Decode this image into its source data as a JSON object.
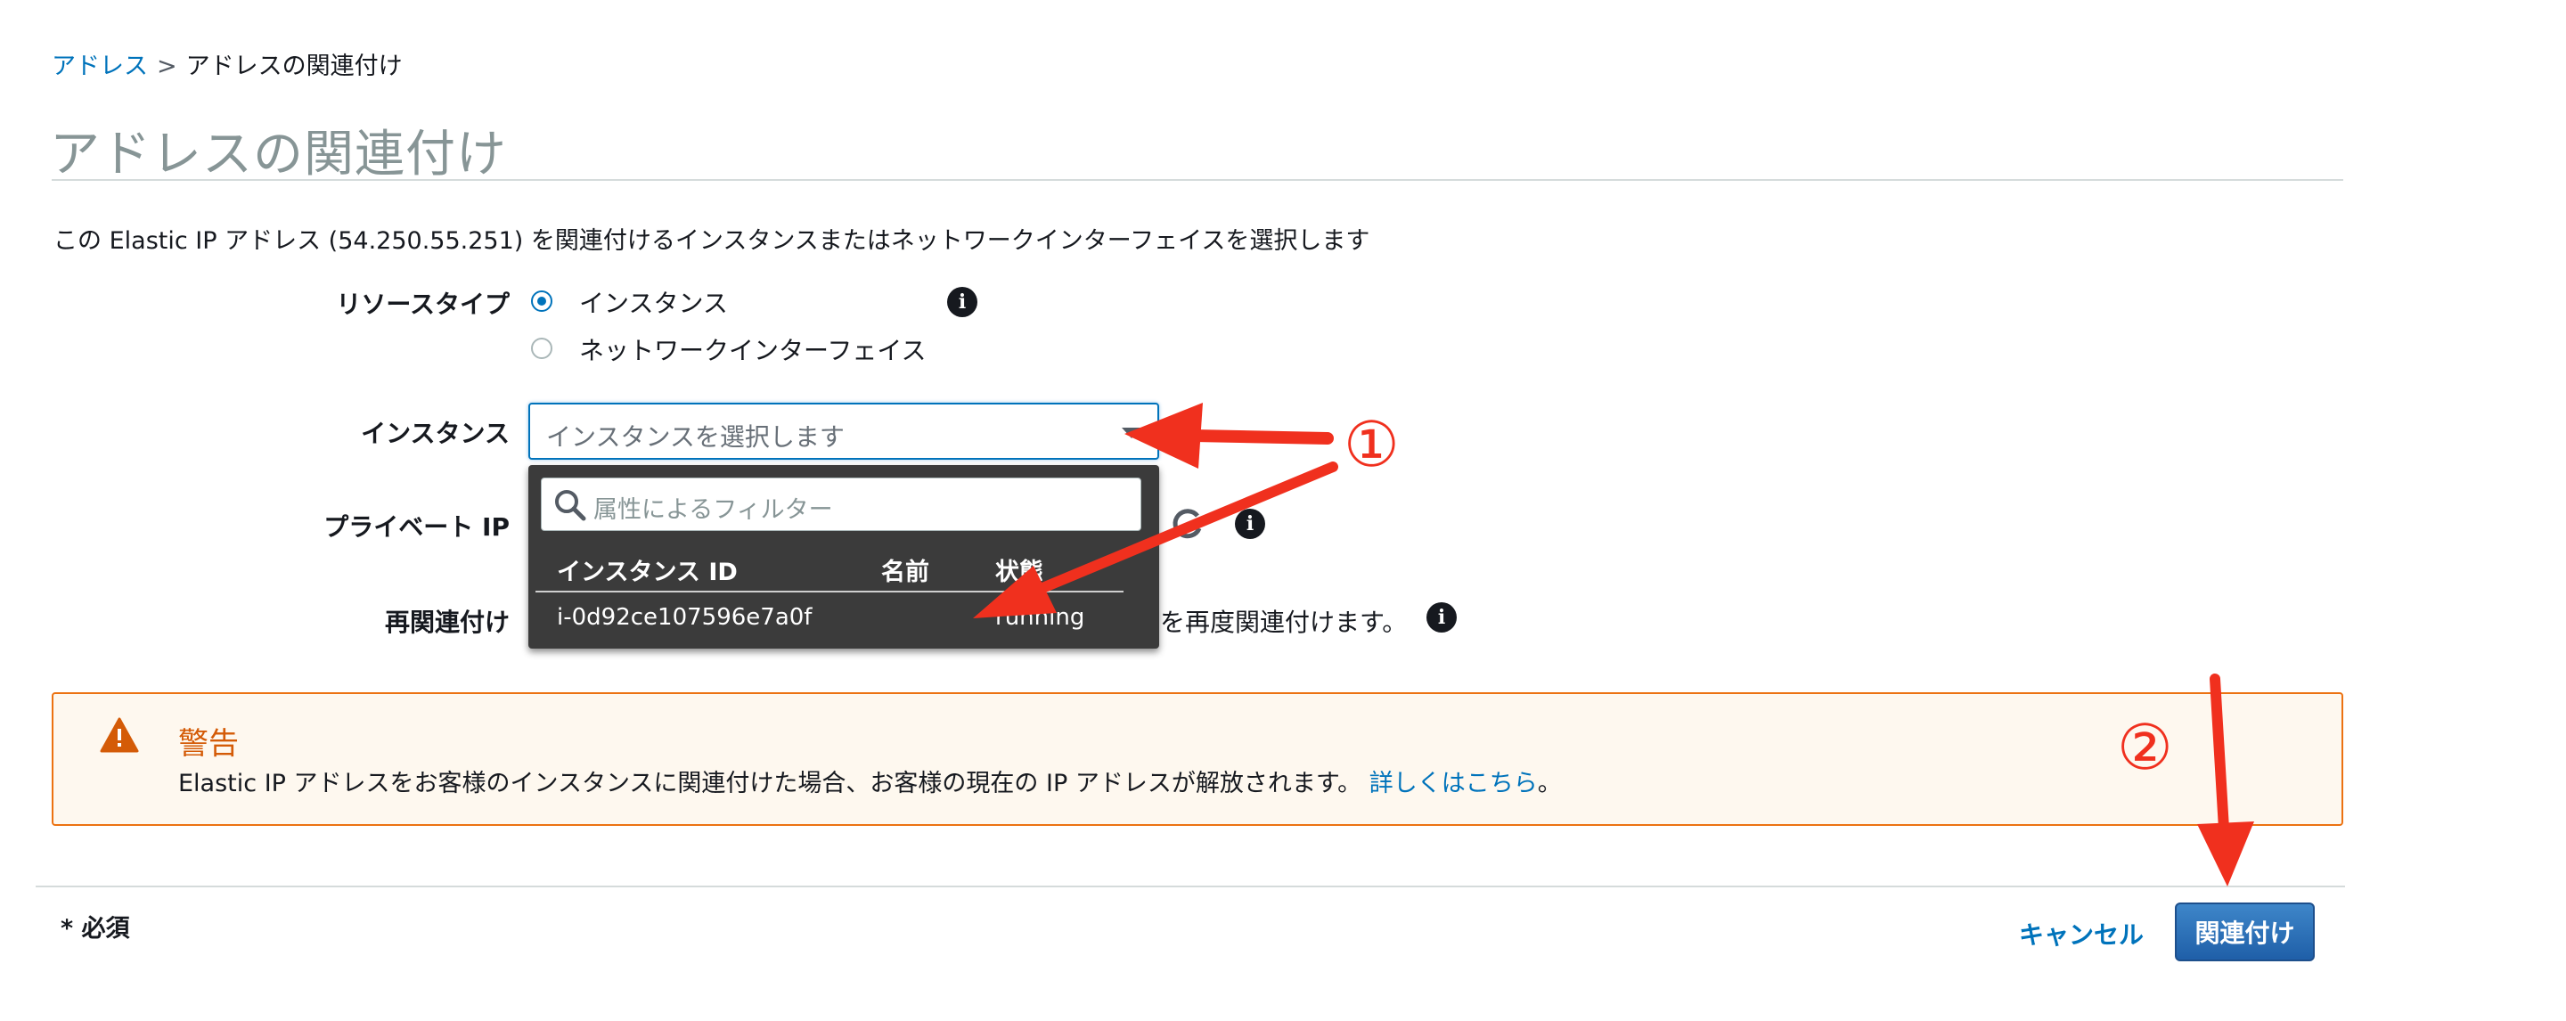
{
  "breadcrumb": {
    "parent": "アドレス",
    "separator": ">",
    "current": "アドレスの関連付け"
  },
  "page_title": "アドレスの関連付け",
  "description": "この Elastic IP アドレス (54.250.55.251) を関連付けるインスタンスまたはネットワークインターフェイスを選択します",
  "form": {
    "resource_type": {
      "label": "リソースタイプ",
      "options": [
        {
          "label": "インスタンス",
          "selected": true
        },
        {
          "label": "ネットワークインターフェイス",
          "selected": false
        }
      ],
      "info_icon": "i"
    },
    "instance": {
      "label": "インスタンス",
      "placeholder": "インスタンスを選択します",
      "dropdown": {
        "filter_placeholder": "属性によるフィルター",
        "columns": [
          "インスタンス ID",
          "名前",
          "状態"
        ],
        "rows": [
          {
            "id": "i-0d92ce107596e7a0f",
            "name": "",
            "state": "running"
          }
        ]
      }
    },
    "private_ip": {
      "label": "プライベート IP",
      "info_icon": "i"
    },
    "reassociation": {
      "label": "再関連付け",
      "text": "を再度関連付けます。",
      "info_icon": "i"
    }
  },
  "warning": {
    "title": "警告",
    "body": "Elastic IP アドレスをお客様のインスタンスに関連付けた場合、お客様の現在の IP アドレスが解放されます。",
    "link": "詳しくはこちら",
    "suffix": "。"
  },
  "footer": {
    "required_note": "* 必須",
    "cancel_label": "キャンセル",
    "associate_label": "関連付け"
  },
  "annotations": {
    "marker_1": "①",
    "marker_2": "②",
    "color": "#f0301e"
  },
  "colors": {
    "link": "#0073bb",
    "warning_border": "#ec7211",
    "warning_title": "#d45b07",
    "primary_button": "#1f5fa8"
  },
  "icons": [
    "info-icon",
    "search-icon",
    "chevron-down-icon",
    "refresh-icon",
    "warning-icon"
  ]
}
